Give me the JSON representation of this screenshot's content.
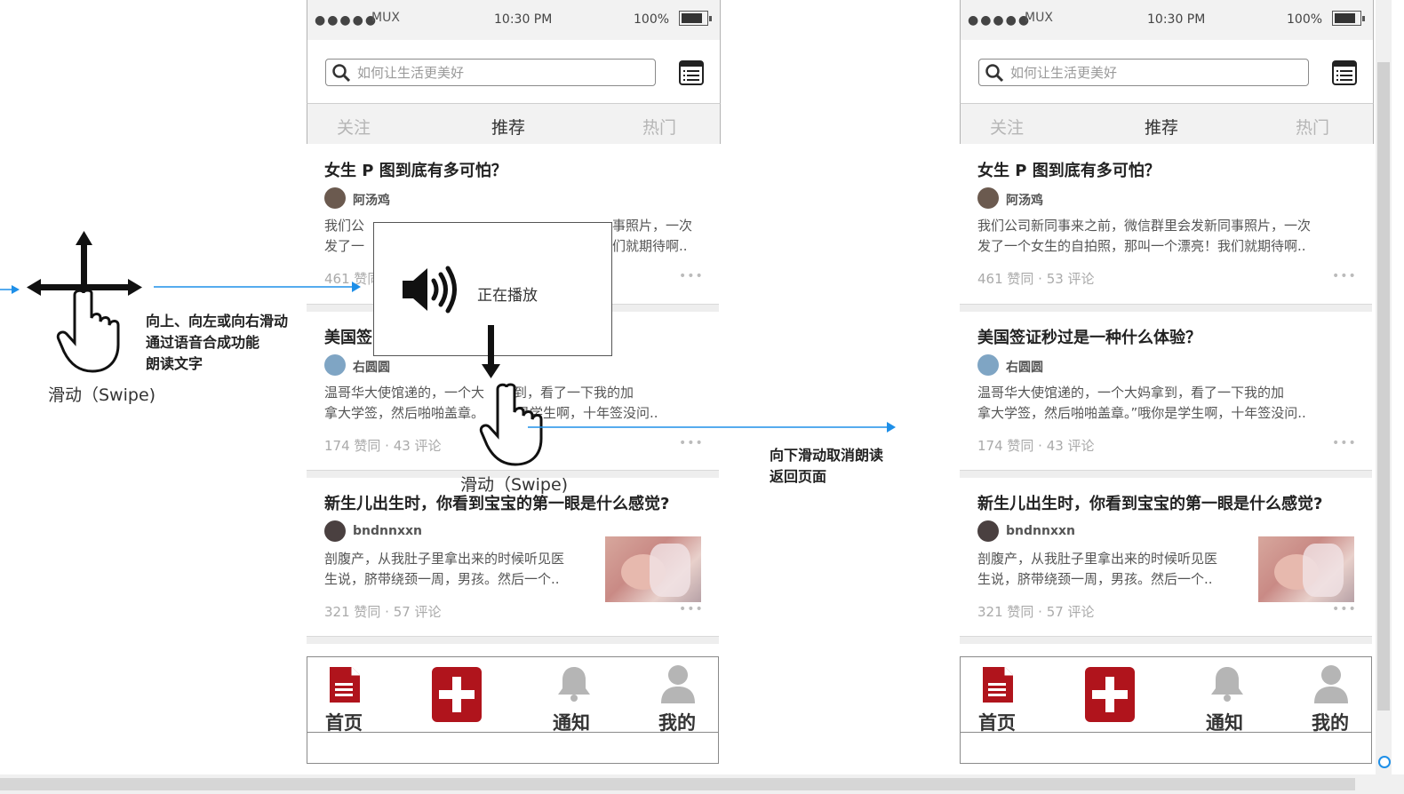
{
  "status": {
    "carrier": "MUX",
    "dots": "●●●●●",
    "time": "10:30 PM",
    "battery": "100%"
  },
  "search": {
    "placeholder": "如何让生活更美好"
  },
  "tabs": [
    {
      "label": "关注"
    },
    {
      "label": "推荐"
    },
    {
      "label": "热门"
    }
  ],
  "feed_left": [
    {
      "title": "女生 P 图到底有多可怕？",
      "author": "阿汤鸡",
      "line1": "我们公",
      "line1b": "事照片，一次",
      "line2": "发了一",
      "line2b": "们就期待啊..",
      "meta": "461 赞同",
      "more": "•••"
    },
    {
      "title": "美国签",
      "author": "右圆圆",
      "line1": "温哥华大使馆递的，一个大",
      "line1b": "拿到，看了一下我的加",
      "line2": "拿大学签，然后啪啪盖章。",
      "line2b": "是学生啊，十年签没问..",
      "meta": "174 赞同 · 43 评论",
      "more": "•••"
    },
    {
      "title": "新生儿出生时，你看到宝宝的第一眼是什么感觉?",
      "author": "bndnnxxn",
      "line1": "剖腹产，从我肚子里拿出来的时候听见医",
      "line2": "生说，脐带绕颈一周，男孩。然后一个..",
      "meta": "321 赞同 · 57 评论",
      "more": "•••"
    }
  ],
  "feed_right": [
    {
      "title": "女生 P 图到底有多可怕？",
      "author": "阿汤鸡",
      "line1": "我们公司新同事来之前，微信群里会发新同事照片，一次",
      "line2": "发了一个女生的自拍照，那叫一个漂亮！我们就期待啊..",
      "meta": "461 赞同 · 53 评论",
      "more": "•••"
    },
    {
      "title": "美国签证秒过是一种什么体验？",
      "author": "右圆圆",
      "line1": "温哥华大使馆递的，一个大妈拿到，看了一下我的加",
      "line2": "拿大学签，然后啪啪盖章。”哦你是学生啊，十年签没问..",
      "meta": "174 赞同 · 43 评论",
      "more": "•••"
    },
    {
      "title": "新生儿出生时，你看到宝宝的第一眼是什么感觉?",
      "author": "bndnnxxn",
      "line1": "剖腹产，从我肚子里拿出来的时候听见医",
      "line2": "生说，脐带绕颈一周，男孩。然后一个..",
      "meta": "321 赞同 · 57 评论",
      "more": "•••"
    }
  ],
  "bottom_nav": [
    {
      "label": "首页"
    },
    {
      "label": "通知"
    },
    {
      "label": "我的"
    }
  ],
  "overlay": {
    "playing": "正在播放"
  },
  "annotations": {
    "left_1": "向上、向左或向右滑动",
    "left_2": "通过语音合成功能",
    "left_3": "朗读文字",
    "swipe_left": "滑动（Swipe)",
    "swipe_mid": "滑动（Swipe)",
    "right_1": "向下滑动取消朗读",
    "right_2": "返回页面"
  },
  "colors": {
    "accent": "#b0141c",
    "arrow": "#1e8fe8"
  }
}
